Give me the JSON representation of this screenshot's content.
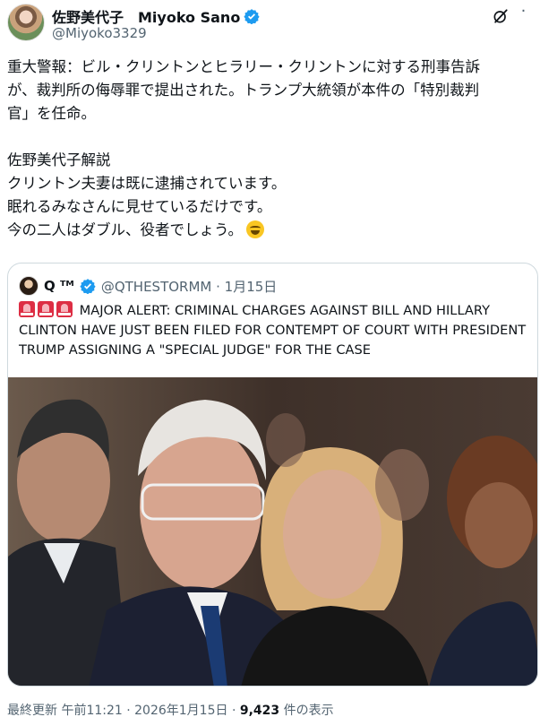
{
  "author": {
    "display_name": "佐野美代子　Miyoko Sano",
    "handle": "@Miyoko3329"
  },
  "tweet": {
    "lines": [
      "重大警報：ビル・クリントンとヒラリー・クリントンに対する刑事告訴",
      "が、裁判所の侮辱罪で提出された。トランプ大統領が本件の「特別裁判",
      "官」を任命。",
      "",
      "佐野美代子解説",
      "クリントン夫妻は既に逮捕されています。",
      "眠れるみなさんに見せているだけです。",
      "今の二人はダブル、役者でしょう。"
    ]
  },
  "quote": {
    "name": "Q ᵀᴹ",
    "handle_date": "@QTHESTORMM · 1月15日",
    "lines": [
      "MAJOR ALERT: CRIMINAL CHARGES AGAINST BILL AND HILLARY",
      "CLINTON HAVE JUST BEEN FILED FOR CONTEMPT OF COURT WITH PRESIDENT",
      "TRUMP ASSIGNING A \"SPECIAL JUDGE\" FOR THE CASE"
    ]
  },
  "footer": {
    "meta": "最終更新 午前11:21 · 2026年1月15日 · ",
    "views": "9,423",
    "views_suffix": " 件の表示"
  },
  "colors": {
    "text": "#0f1419",
    "secondary": "#536471",
    "verified": "#1d9bf0",
    "border": "#cfd9de"
  }
}
